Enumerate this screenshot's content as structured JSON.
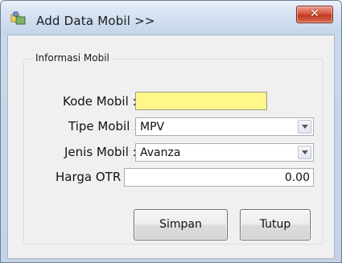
{
  "window": {
    "title": "Add Data Mobil >>",
    "icon": "app-icon",
    "close_icon": "close-icon"
  },
  "group": {
    "label": "Informasi Mobil"
  },
  "fields": {
    "kode": {
      "label": "Kode Mobil :",
      "value": ""
    },
    "tipe": {
      "label": "Tipe Mobil :",
      "value": "MPV"
    },
    "jenis": {
      "label": "Jenis Mobil :",
      "value": "Avanza"
    },
    "harga": {
      "label": "Harga OTR :",
      "value": "0.00"
    }
  },
  "buttons": {
    "simpan": "Simpan",
    "tutup": "Tutup"
  },
  "colors": {
    "highlight_field": "#fff78a",
    "close_button": "#c13a22"
  }
}
